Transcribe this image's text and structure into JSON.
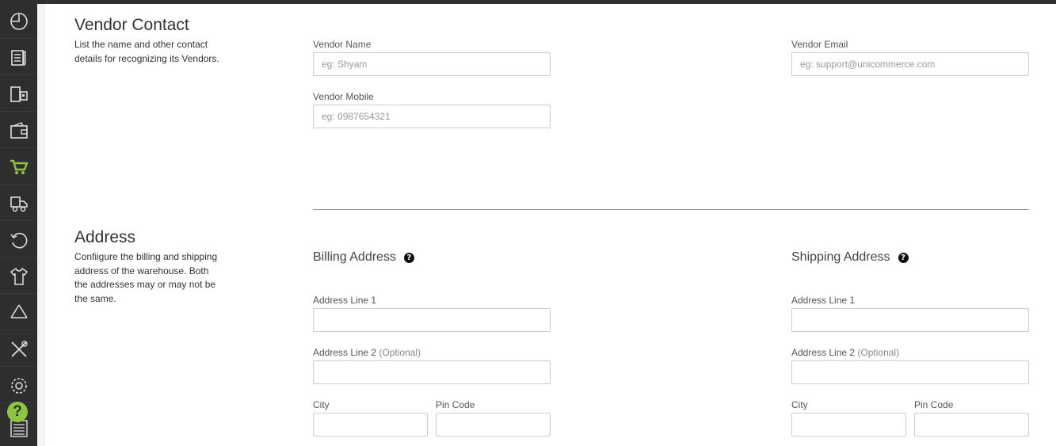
{
  "sidebar": {
    "items": [
      {
        "icon": "dashboard-pie-icon"
      },
      {
        "icon": "orders-document-icon"
      },
      {
        "icon": "inventory-shelf-icon"
      },
      {
        "icon": "wallet-icon"
      },
      {
        "icon": "cart-icon",
        "active": true
      },
      {
        "icon": "truck-icon"
      },
      {
        "icon": "returns-icon"
      },
      {
        "icon": "products-shirt-icon"
      },
      {
        "icon": "recycle-icon"
      },
      {
        "icon": "tools-icon"
      },
      {
        "icon": "settings-gear-icon"
      },
      {
        "icon": "barcode-icon"
      }
    ],
    "help_label": "?",
    "accent": "#8cc63f"
  },
  "vendor_contact": {
    "title": "Vendor Contact",
    "description": "List the name and other contact details for recognizing its Vendors.",
    "vendor_name_label": "Vendor Name",
    "vendor_name_placeholder": "eg: Shyam",
    "vendor_name_value": "",
    "vendor_email_label": "Vendor Email",
    "vendor_email_placeholder": "eg: support@unicommerce.com",
    "vendor_email_value": "",
    "vendor_mobile_label": "Vendor Mobile",
    "vendor_mobile_placeholder": "eg: 0987654321",
    "vendor_mobile_value": ""
  },
  "address": {
    "title": "Address",
    "description": "Confiigure the billing and shipping address of the warehouse. Both the addresses may or may not be the same.",
    "billing": {
      "title": "Billing Address",
      "line1_label": "Address Line 1",
      "line2_label": "Address Line 2",
      "line2_optional": "(Optional)",
      "city_label": "City",
      "pin_label": "Pin Code"
    },
    "shipping": {
      "title": "Shipping Address",
      "line1_label": "Address Line 1",
      "line2_label": "Address Line 2",
      "line2_optional": "(Optional)",
      "city_label": "City",
      "pin_label": "Pin Code"
    },
    "help_glyph": "?"
  }
}
